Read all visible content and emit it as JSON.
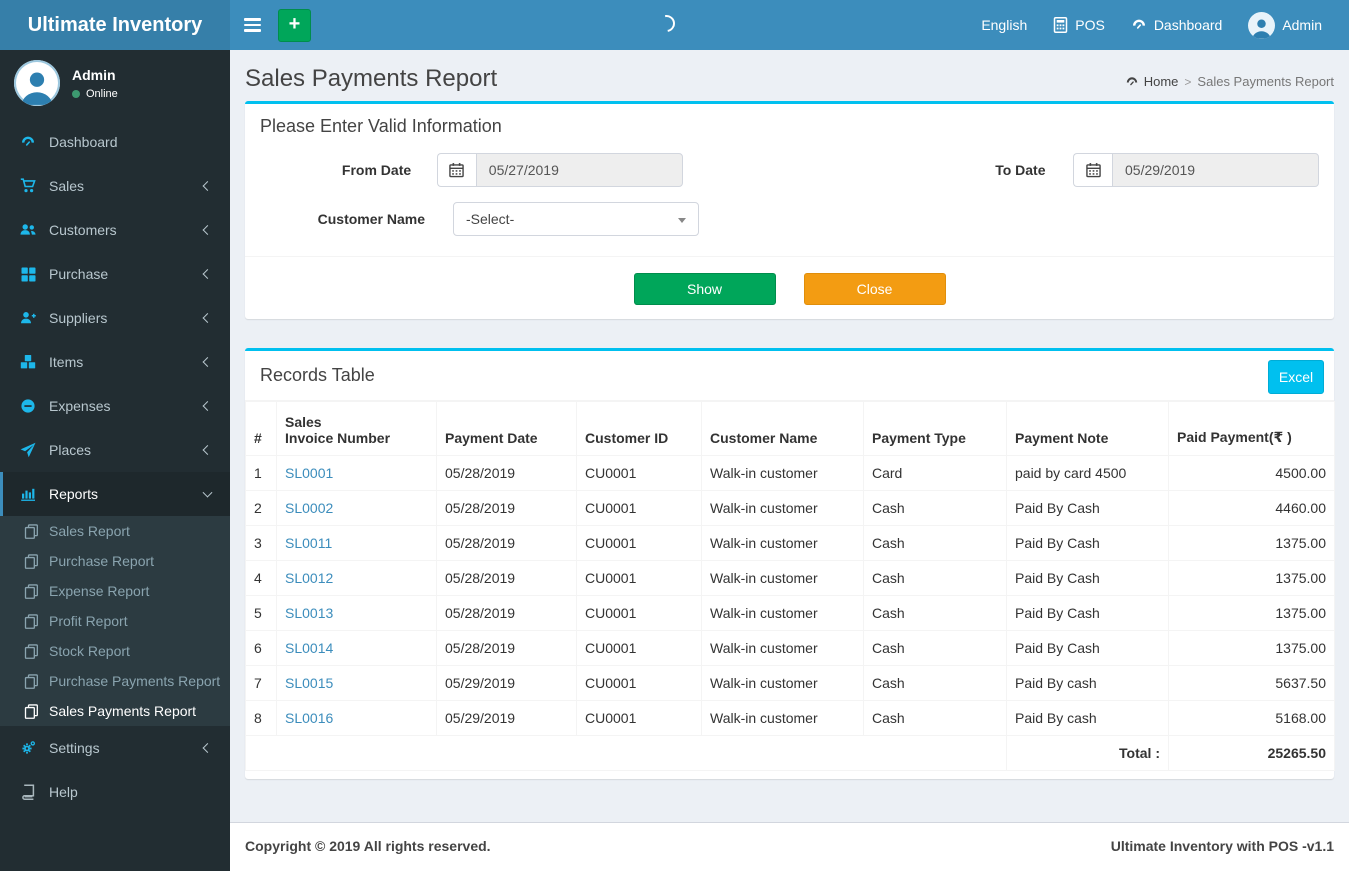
{
  "theme": {
    "navbar_bg": "#3c8dbc",
    "logo_bg": "#367fa9",
    "sidebar_bg": "#222d32",
    "sidebar_icon": "#1db7ea",
    "accent": "#00c0ef",
    "success": "#00a65a",
    "warning": "#f39c12",
    "link": "#3c8dbc"
  },
  "navbar": {
    "brand": "Ultimate Inventory",
    "language": "English",
    "pos": "POS",
    "dashboard": "Dashboard",
    "user": "Admin"
  },
  "sidebar": {
    "user_name": "Admin",
    "user_status": "Online",
    "items": [
      {
        "label": "Dashboard"
      },
      {
        "label": "Sales"
      },
      {
        "label": "Customers"
      },
      {
        "label": "Purchase"
      },
      {
        "label": "Suppliers"
      },
      {
        "label": "Items"
      },
      {
        "label": "Expenses"
      },
      {
        "label": "Places"
      },
      {
        "label": "Reports"
      },
      {
        "label": "Settings"
      },
      {
        "label": "Help"
      }
    ],
    "reports_submenu": [
      {
        "label": "Sales Report"
      },
      {
        "label": "Purchase Report"
      },
      {
        "label": "Expense Report"
      },
      {
        "label": "Profit Report"
      },
      {
        "label": "Stock Report"
      },
      {
        "label": "Purchase Payments Report"
      },
      {
        "label": "Sales Payments Report"
      }
    ]
  },
  "page": {
    "title": "Sales Payments Report",
    "breadcrumb_home": "Home",
    "breadcrumb_separator": ">",
    "breadcrumb_current": "Sales Payments Report"
  },
  "filter": {
    "heading": "Please Enter Valid Information",
    "from_date_label": "From Date",
    "from_date_value": "05/27/2019",
    "to_date_label": "To Date",
    "to_date_value": "05/29/2019",
    "customer_label": "Customer Name",
    "customer_value": "-Select-",
    "show_label": "Show",
    "close_label": "Close"
  },
  "records": {
    "heading": "Records Table",
    "excel_label": "Excel",
    "columns": {
      "num": "#",
      "invoice": "Sales\nInvoice Number",
      "date": "Payment Date",
      "customer_id": "Customer ID",
      "customer_name": "Customer Name",
      "type": "Payment Type",
      "note": "Payment Note",
      "paid": "Paid Payment(₹ )"
    },
    "rows": [
      {
        "num": "1",
        "invoice": "SL0001",
        "date": "05/28/2019",
        "customer_id": "CU0001",
        "customer_name": "Walk-in customer",
        "type": "Card",
        "note": "paid by card 4500",
        "amount": "4500.00"
      },
      {
        "num": "2",
        "invoice": "SL0002",
        "date": "05/28/2019",
        "customer_id": "CU0001",
        "customer_name": "Walk-in customer",
        "type": "Cash",
        "note": "Paid By Cash",
        "amount": "4460.00"
      },
      {
        "num": "3",
        "invoice": "SL0011",
        "date": "05/28/2019",
        "customer_id": "CU0001",
        "customer_name": "Walk-in customer",
        "type": "Cash",
        "note": "Paid By Cash",
        "amount": "1375.00"
      },
      {
        "num": "4",
        "invoice": "SL0012",
        "date": "05/28/2019",
        "customer_id": "CU0001",
        "customer_name": "Walk-in customer",
        "type": "Cash",
        "note": "Paid By Cash",
        "amount": "1375.00"
      },
      {
        "num": "5",
        "invoice": "SL0013",
        "date": "05/28/2019",
        "customer_id": "CU0001",
        "customer_name": "Walk-in customer",
        "type": "Cash",
        "note": "Paid By Cash",
        "amount": "1375.00"
      },
      {
        "num": "6",
        "invoice": "SL0014",
        "date": "05/28/2019",
        "customer_id": "CU0001",
        "customer_name": "Walk-in customer",
        "type": "Cash",
        "note": "Paid By Cash",
        "amount": "1375.00"
      },
      {
        "num": "7",
        "invoice": "SL0015",
        "date": "05/29/2019",
        "customer_id": "CU0001",
        "customer_name": "Walk-in customer",
        "type": "Cash",
        "note": "Paid By cash",
        "amount": "5637.50"
      },
      {
        "num": "8",
        "invoice": "SL0016",
        "date": "05/29/2019",
        "customer_id": "CU0001",
        "customer_name": "Walk-in customer",
        "type": "Cash",
        "note": "Paid By cash",
        "amount": "5168.00"
      }
    ],
    "total_label": "Total :",
    "total_value": "25265.50"
  },
  "footer": {
    "copyright": "Copyright © 2019 All rights reserved.",
    "version": "Ultimate Inventory with POS -v1.1"
  }
}
